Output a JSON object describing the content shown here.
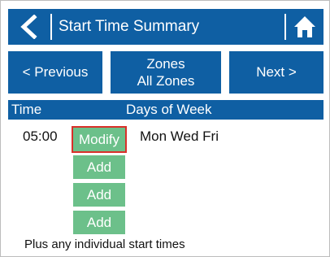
{
  "titlebar": {
    "title": "Start Time Summary",
    "back_icon": "chevron-left-icon",
    "home_icon": "home-icon"
  },
  "nav": {
    "previous_label": "< Previous",
    "zones_line1": "Zones",
    "zones_line2": "All Zones",
    "next_label": "Next >"
  },
  "table": {
    "headers": {
      "time": "Time",
      "days": "Days of Week"
    },
    "rows": [
      {
        "time": "05:00",
        "action": "Modify",
        "days": "Mon Wed Fri"
      }
    ],
    "add_buttons": [
      "Add",
      "Add",
      "Add"
    ]
  },
  "footer": {
    "note": "Plus any individual start times"
  },
  "colors": {
    "primary_blue": "#0f5fa3",
    "button_green": "#6cc08a",
    "highlight_red": "#d9302a"
  }
}
